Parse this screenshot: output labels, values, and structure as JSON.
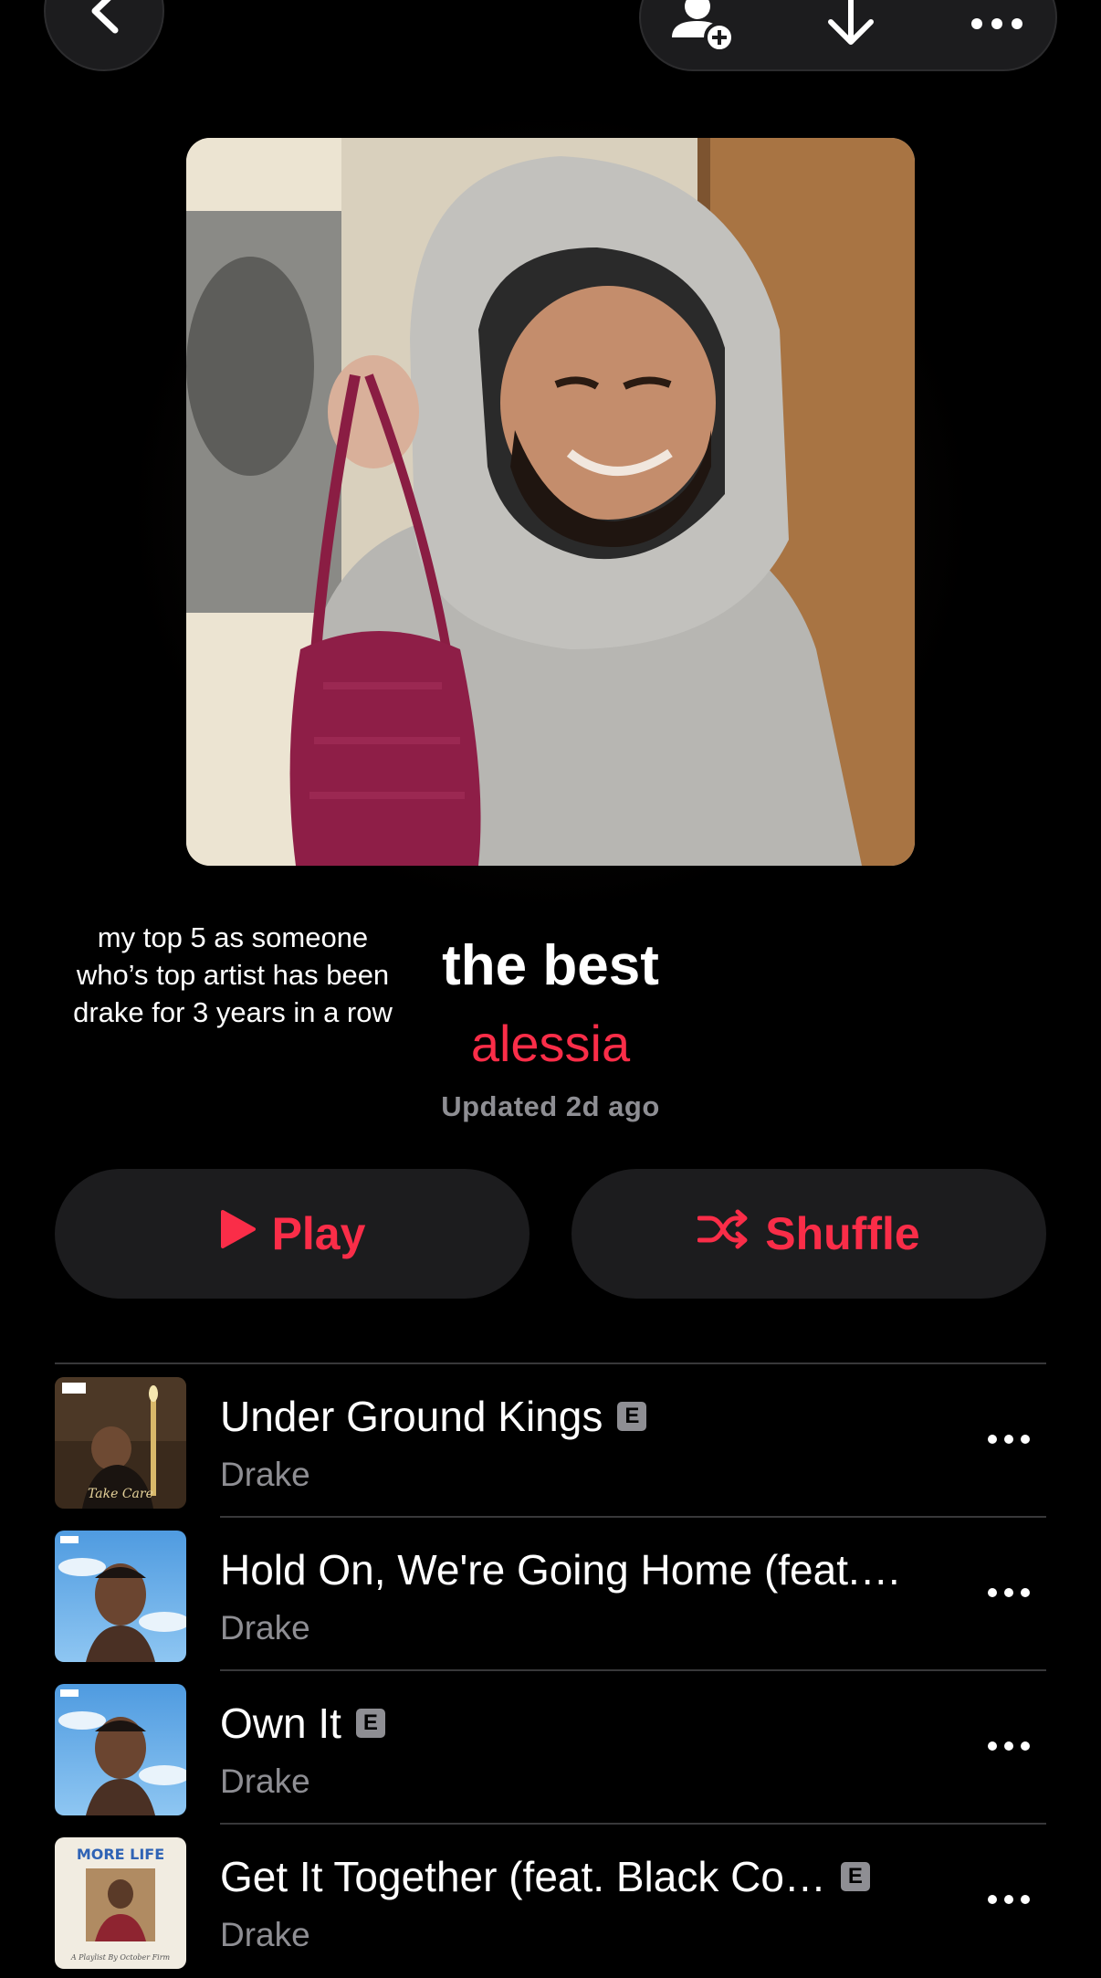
{
  "header": {
    "back_icon": "chevron-left-icon",
    "actions": [
      {
        "icon": "add-person-icon"
      },
      {
        "icon": "download-icon"
      },
      {
        "icon": "more-icon"
      }
    ]
  },
  "playlist": {
    "artwork_caption": "my top 5 as someone\nwho’s top artist has been\ndrake for 3 years in a row",
    "title": "the best",
    "curator": "alessia",
    "updated": "Updated 2d ago"
  },
  "controls": {
    "play_label": "Play",
    "shuffle_label": "Shuffle"
  },
  "tracks": [
    {
      "title": "Under Ground Kings",
      "artist": "Drake",
      "explicit": true
    },
    {
      "title": "Hold On, We're Going Home (feat.…",
      "artist": "Drake",
      "explicit": false
    },
    {
      "title": "Own It",
      "artist": "Drake",
      "explicit": true
    },
    {
      "title": "Get It Together (feat. Black Co…",
      "artist": "Drake",
      "explicit": true
    }
  ],
  "explicit_badge": "E",
  "colors": {
    "accent": "#fa2d48",
    "background": "#000000",
    "surface": "#1c1c1e",
    "secondary_text": "#8e8e93"
  }
}
